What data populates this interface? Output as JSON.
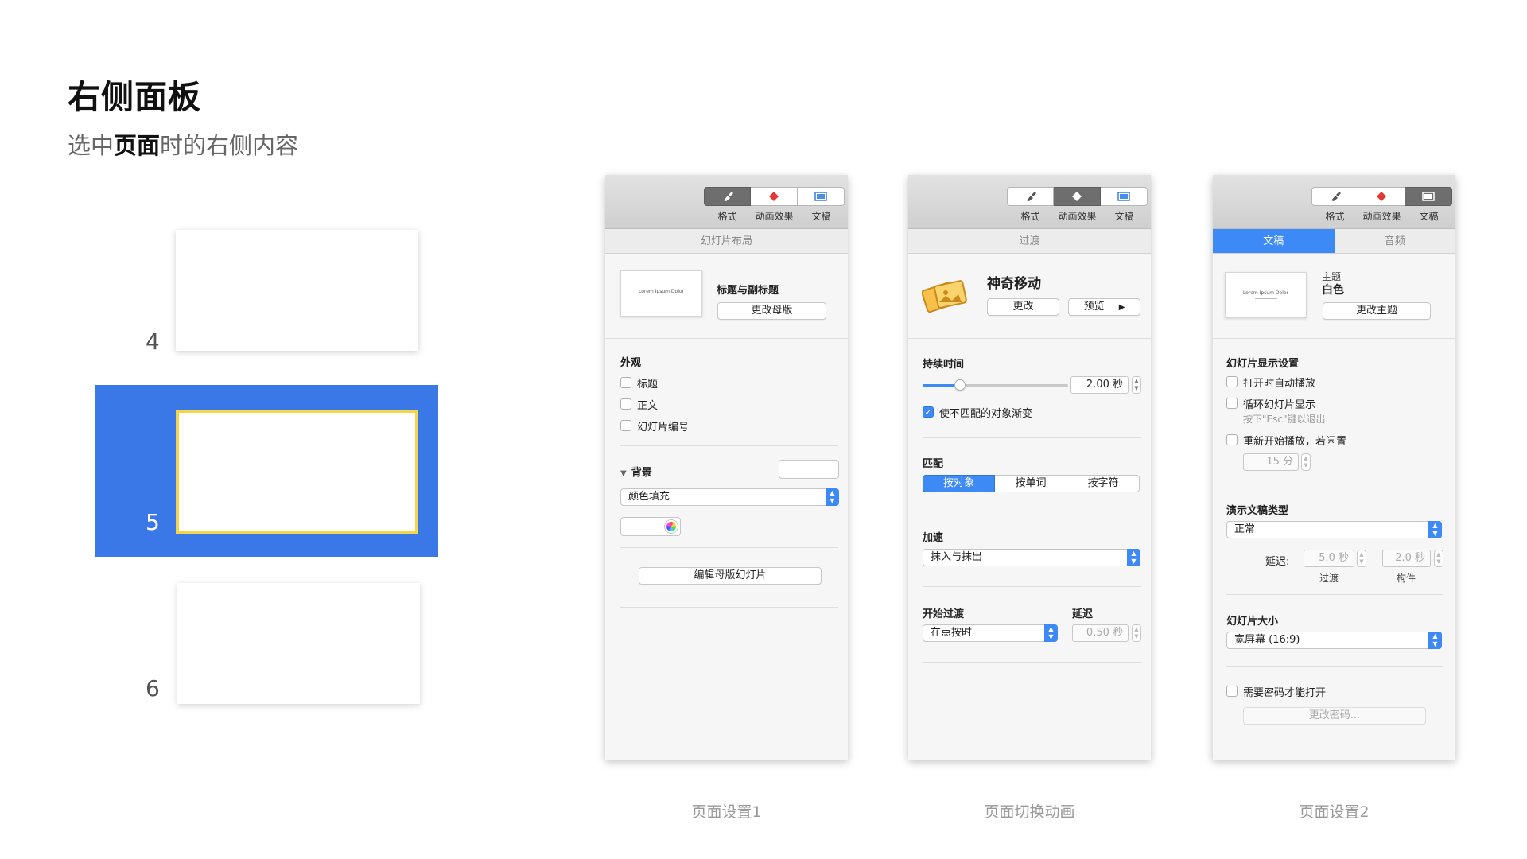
{
  "header": {
    "title": "右侧面板",
    "subtitle_pre": "选中",
    "subtitle_bold": "页面",
    "subtitle_post": "时的右侧内容"
  },
  "slides": {
    "num4": "4",
    "num5": "5",
    "num6": "6"
  },
  "toolbar": {
    "format": "格式",
    "animate": "动画效果",
    "document": "文稿"
  },
  "panel1": {
    "header": "幻灯片布局",
    "thumb_text": "Lorem Ipsum Dolor",
    "layout_name": "标题与副标题",
    "change_master": "更改母版",
    "appearance": "外观",
    "opt_title": "标题",
    "opt_body": "正文",
    "opt_number": "幻灯片编号",
    "background": "背景",
    "fill_type": "颜色填充",
    "edit_master": "编辑母版幻灯片",
    "caption": "页面设置1"
  },
  "panel2": {
    "header": "过渡",
    "effect_name": "神奇移动",
    "change": "更改",
    "preview": "预览",
    "duration_label": "持续时间",
    "duration_value": "2.00 秒",
    "fade_label": "使不匹配的对象渐变",
    "match_label": "匹配",
    "match_options": [
      "按对象",
      "按单词",
      "按字符"
    ],
    "accel_label": "加速",
    "accel_value": "抹入与抹出",
    "start_label": "开始过渡",
    "delay_label": "延迟",
    "start_value": "在点按时",
    "delay_value": "0.50 秒",
    "caption": "页面切换动画"
  },
  "panel3": {
    "tab_document": "文稿",
    "tab_audio": "音频",
    "thumb_text": "Lorem Ipsum Dolor",
    "theme_label": "主题",
    "theme_value": "白色",
    "change_theme": "更改主题",
    "display_settings": "幻灯片显示设置",
    "autoplay": "打开时自动播放",
    "loop": "循环幻灯片显示",
    "loop_hint": "按下\"Esc\"键以退出",
    "restart": "重新开始播放，若闲置",
    "restart_value": "15 分",
    "type_label": "演示文稿类型",
    "type_value": "正常",
    "delay_label": "延迟:",
    "transition_delay": "5.0 秒",
    "build_delay": "2.0 秒",
    "transition_caption": "过渡",
    "build_caption": "构件",
    "size_label": "幻灯片大小",
    "size_value": "宽屏幕 (16:9)",
    "password_label": "需要密码才能打开",
    "change_password": "更改密码...",
    "caption": "页面设置2"
  }
}
